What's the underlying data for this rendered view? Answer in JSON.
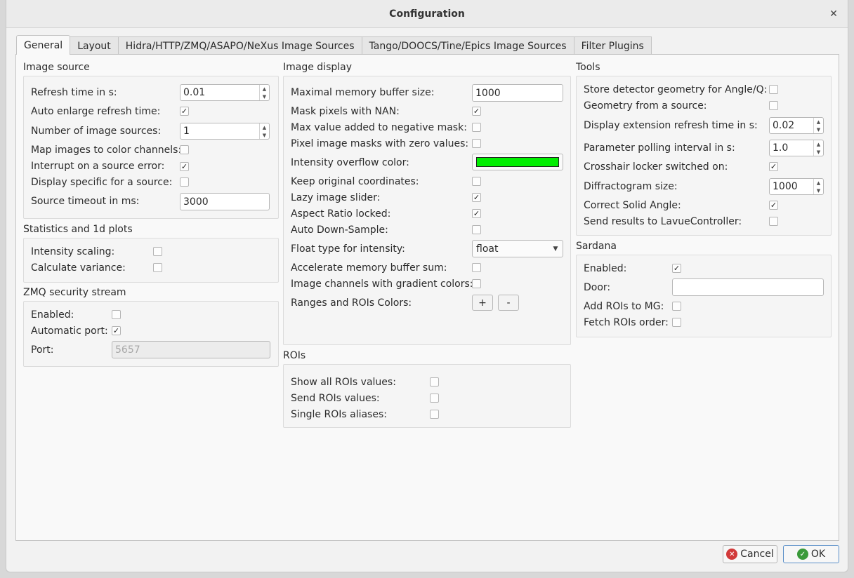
{
  "window": {
    "title": "Configuration",
    "close_glyph": "✕"
  },
  "tabs": [
    {
      "label": "General"
    },
    {
      "label": "Layout"
    },
    {
      "label": "Hidra/HTTP/ZMQ/ASAPO/NeXus Image Sources"
    },
    {
      "label": "Tango/DOOCS/Tine/Epics Image Sources"
    },
    {
      "label": "Filter Plugins"
    }
  ],
  "image_source": {
    "title": "Image source",
    "refresh_time": {
      "label": "Refresh time in s:",
      "value": "0.01"
    },
    "auto_enlarge": {
      "label": "Auto enlarge refresh time:",
      "checked": true
    },
    "num_sources": {
      "label": "Number of image sources:",
      "value": "1"
    },
    "map_color": {
      "label": "Map images to color channels:",
      "checked": false
    },
    "interrupt": {
      "label": "Interrupt on a source error:",
      "checked": true
    },
    "display_specific": {
      "label": "Display specific for a source:",
      "checked": false
    },
    "timeout": {
      "label": "Source timeout in ms:",
      "value": "3000"
    }
  },
  "statistics": {
    "title": "Statistics and 1d plots",
    "intensity_scaling": {
      "label": "Intensity scaling:",
      "checked": false
    },
    "calc_variance": {
      "label": "Calculate variance:",
      "checked": false
    }
  },
  "zmq": {
    "title": "ZMQ security stream",
    "enabled": {
      "label": "Enabled:",
      "checked": false
    },
    "auto_port": {
      "label": "Automatic port:",
      "checked": true
    },
    "port": {
      "label": "Port:",
      "value": "5657"
    }
  },
  "image_display": {
    "title": "Image display",
    "buffer_size": {
      "label": "Maximal memory buffer size:",
      "value": "1000"
    },
    "mask_nan": {
      "label": "Mask pixels with NAN:",
      "checked": true
    },
    "max_neg_mask": {
      "label": "Max value added to negative mask:",
      "checked": false
    },
    "pixel_masks": {
      "label": "Pixel image masks with zero values:",
      "checked": false
    },
    "overflow_color": {
      "label": "Intensity overflow color:",
      "color": "#00ee00"
    },
    "keep_coords": {
      "label": "Keep original coordinates:",
      "checked": false
    },
    "lazy_slider": {
      "label": "Lazy image slider:",
      "checked": true
    },
    "aspect_ratio": {
      "label": "Aspect Ratio locked:",
      "checked": true
    },
    "auto_downsample": {
      "label": "Auto Down-Sample:",
      "checked": false
    },
    "float_type": {
      "label": "Float type for intensity:",
      "value": "float"
    },
    "accel_buffer": {
      "label": "Accelerate memory buffer sum:",
      "checked": false
    },
    "gradient_channels": {
      "label": "Image channels with gradient colors:",
      "checked": false
    },
    "roi_colors": {
      "label": "Ranges and ROIs Colors:",
      "plus": "+",
      "minus": "-"
    }
  },
  "rois": {
    "title": "ROIs",
    "show_all": {
      "label": "Show all ROIs values:",
      "checked": false
    },
    "send": {
      "label": "Send ROIs values:",
      "checked": false
    },
    "single_aliases": {
      "label": "Single ROIs aliases:",
      "checked": false
    }
  },
  "tools": {
    "title": "Tools",
    "store_geometry": {
      "label": "Store detector geometry for Angle/Q:",
      "checked": false
    },
    "geometry_source": {
      "label": "Geometry from a source:",
      "checked": false
    },
    "ext_refresh": {
      "label": "Display extension refresh time in s:",
      "value": "0.02"
    },
    "polling": {
      "label": "Parameter polling interval in s:",
      "value": "1.0"
    },
    "crosshair": {
      "label": "Crosshair locker switched on:",
      "checked": true
    },
    "diffractogram": {
      "label": "Diffractogram size:",
      "value": "1000"
    },
    "solid_angle": {
      "label": "Correct Solid Angle:",
      "checked": true
    },
    "lavue_ctrl": {
      "label": "Send results to LavueController:",
      "checked": false
    }
  },
  "sardana": {
    "title": "Sardana",
    "enabled": {
      "label": "Enabled:",
      "checked": true
    },
    "door": {
      "label": "Door:",
      "value": ""
    },
    "add_rois": {
      "label": "Add ROIs to MG:",
      "checked": false
    },
    "fetch_order": {
      "label": "Fetch ROIs order:",
      "checked": false
    }
  },
  "buttons": {
    "cancel": "Cancel",
    "ok": "OK"
  },
  "check_glyph": "✓"
}
